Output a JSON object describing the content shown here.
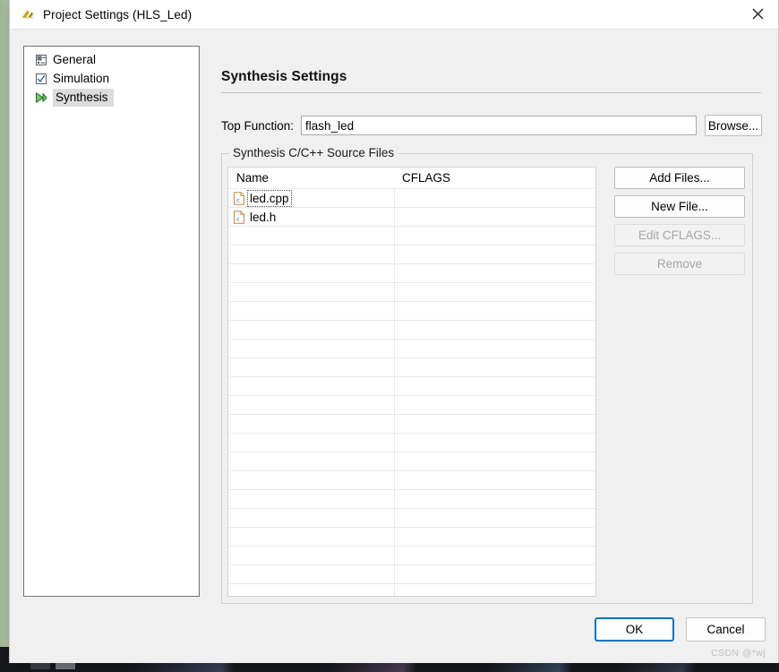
{
  "window": {
    "title": "Project Settings (HLS_Led)",
    "app_icon": "vitis-hls-icon",
    "close_label": "✕"
  },
  "nav_tree": {
    "items": [
      {
        "label": "General",
        "icon": "properties-icon",
        "selected": false
      },
      {
        "label": "Simulation",
        "icon": "checkbox-checked-icon",
        "selected": false
      },
      {
        "label": "Synthesis",
        "icon": "green-play-icon",
        "selected": true
      }
    ]
  },
  "content": {
    "section_title": "Synthesis Settings",
    "top_function": {
      "label": "Top Function:",
      "value": "flash_led",
      "placeholder": "",
      "browse_label": "Browse..."
    },
    "source_files_group": {
      "legend": "Synthesis C/C++ Source Files",
      "table": {
        "columns": [
          "Name",
          "CFLAGS"
        ],
        "rows": [
          {
            "name": "led.cpp",
            "cflags": "",
            "icon": "c-file-icon",
            "focused": true
          },
          {
            "name": "led.h",
            "cflags": "",
            "icon": "c-file-icon",
            "focused": false
          }
        ],
        "empty_row_count": 22
      },
      "buttons": [
        {
          "label": "Add Files...",
          "enabled": true
        },
        {
          "label": "New File...",
          "enabled": true
        },
        {
          "label": "Edit CFLAGS...",
          "enabled": false
        },
        {
          "label": "Remove",
          "enabled": false
        }
      ]
    }
  },
  "footer": {
    "ok_label": "OK",
    "cancel_label": "Cancel",
    "default_button": "OK"
  },
  "watermark": "CSDN @*wj",
  "colors": {
    "dialog_bg": "#f0f0f0",
    "desktop_bg": "#b6c8aa",
    "accent_blue": "#0a74c8",
    "selection_grey": "#dcdcdc",
    "disabled_text": "#a6a6a6",
    "taskbar": "#16181c"
  }
}
